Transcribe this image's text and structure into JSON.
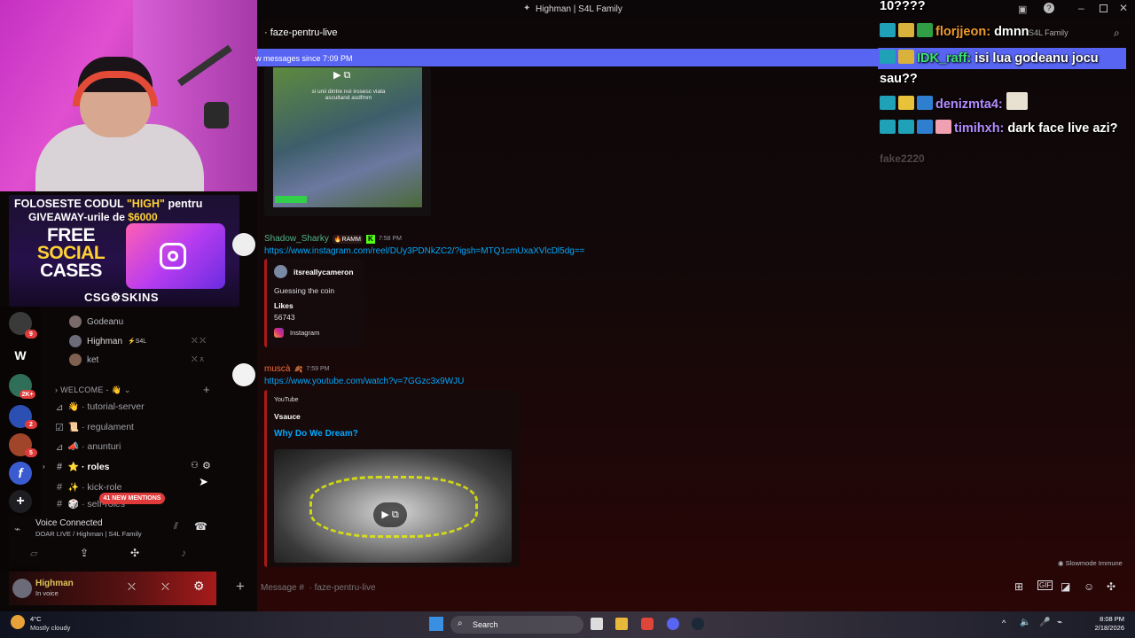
{
  "window": {
    "title": "Highman | S4L Family"
  },
  "channel": {
    "name": "faze-pentru-live",
    "server_label": "S4L Family",
    "new_messages_text": "w messages since 7:09 PM"
  },
  "ad": {
    "line1_pre": "FOLOSESTE CODUL ",
    "line1_code": "\"HIGH\"",
    "line1_post": " pentru",
    "line2_pre": "GIVEAWAY-urile de ",
    "line2_amount": "$6000",
    "big1": "FREE",
    "big2": "SOCIAL",
    "big3": "CASES",
    "logo": "CSG⚙SKINS"
  },
  "servers": [
    {
      "label": "",
      "badge": "9"
    },
    {
      "label": "W",
      "badge": ""
    },
    {
      "label": "",
      "badge": "2K+"
    },
    {
      "label": "",
      "badge": "2"
    },
    {
      "label": "",
      "badge": "5"
    },
    {
      "label": "f",
      "badge": ""
    },
    {
      "label": "+",
      "badge": ""
    }
  ],
  "members": [
    {
      "name": "Godeanu",
      "tag": ""
    },
    {
      "name": "Highman",
      "tag": "⚡S4L"
    },
    {
      "name": "ket",
      "tag": ""
    }
  ],
  "category": {
    "name": "WELCOME - 👋"
  },
  "channels": [
    {
      "icon": "📢",
      "emoji": "👋",
      "name": "· tutorial-server"
    },
    {
      "icon": "☑",
      "emoji": "📜",
      "name": "· regulament"
    },
    {
      "icon": "📢",
      "emoji": "📣",
      "name": "· anunturi"
    },
    {
      "icon": "#",
      "emoji": "⭐",
      "name": "· roles"
    },
    {
      "icon": "#",
      "emoji": "✨",
      "name": "· kick-role"
    },
    {
      "icon": "#",
      "emoji": "🎲",
      "name": "· self-roles"
    }
  ],
  "mentions_pill": "41 NEW MENTIONS",
  "voice": {
    "status": "Voice Connected",
    "location": "DOAR LIVE / Highman | S4L Family"
  },
  "user": {
    "name": "Highman",
    "status": "In voice"
  },
  "messages": [
    {
      "author": "Shadow_Sharky",
      "role": "RAMM",
      "time": "7:58 PM",
      "link": "https://www.instagram.com/reel/DUy3PDNkZC2/?igsh=MTQ1cmUxaXVlcDl5dg==",
      "embed": {
        "account": "itsreallycameron",
        "desc": "Guessing the coin",
        "likes_label": "Likes",
        "likes": "56743",
        "provider": "Instagram"
      }
    },
    {
      "author": "muscà",
      "role": "",
      "time": "7:59 PM",
      "link": "https://www.youtube.com/watch?v=7GGzc3x9WJU",
      "embed": {
        "provider": "YouTube",
        "channel": "Vsauce",
        "title": "Why Do We Dream?"
      }
    }
  ],
  "video_caption": "si unii dintre noi irosesc viata\nascultand asdfmm",
  "overlay_chat": [
    {
      "user": "",
      "text": "10????"
    },
    {
      "user": "florjjeon:",
      "text": "dmnn"
    },
    {
      "user": "IDK_raff:",
      "text": "isi lua godeanu jocu sau??"
    },
    {
      "user": "denizmta4:",
      "text": ""
    },
    {
      "user": "timihxh:",
      "text": "dark face live azi?"
    },
    {
      "user": "fake2220",
      "text": ""
    }
  ],
  "slowmode": "Slowmode Immune",
  "composer": {
    "placeholder": "Message #  · faze-pentru-live"
  },
  "weather": {
    "temp": "4°C",
    "desc": "Mostly cloudy"
  },
  "taskbar": {
    "search": "Search",
    "time": "8:08 PM",
    "date": "2/18/2026"
  },
  "colors": {
    "accent": "#5865f2",
    "link": "#00a8fc",
    "embed_border": "#a71a1a"
  }
}
